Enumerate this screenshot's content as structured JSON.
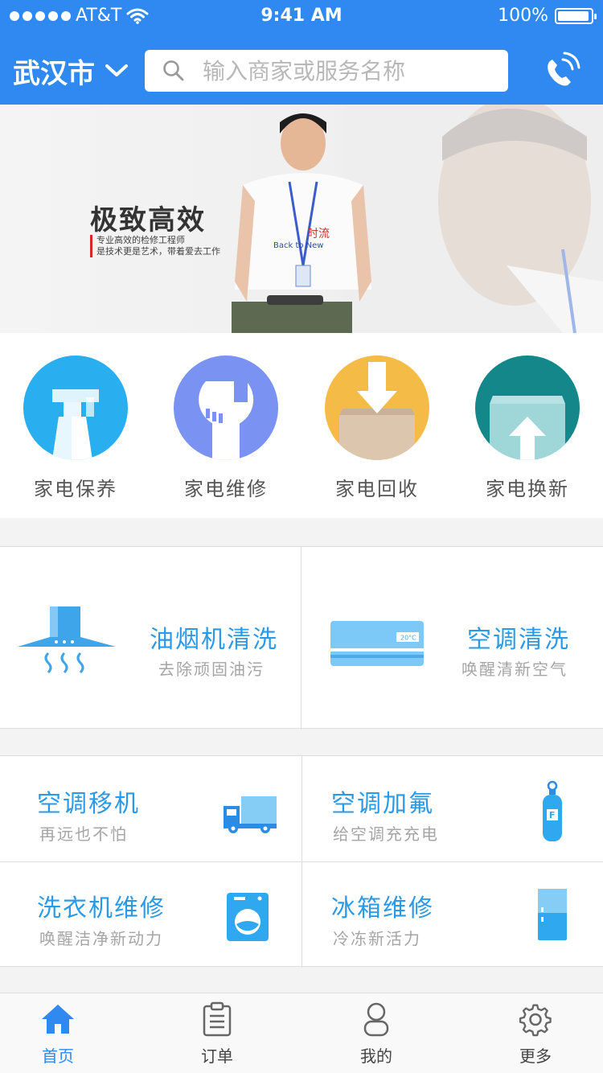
{
  "status_bar": {
    "carrier": "AT&T",
    "time": "9:41 AM",
    "battery": "100%"
  },
  "header": {
    "city": "武汉市",
    "search_placeholder": "输入商家或服务名称",
    "accent_color": "#2f89f0"
  },
  "banner": {
    "title": "极致高效",
    "subtitle_line1": "专业高效的检修工程师",
    "subtitle_line2": "是技术更是艺术，带着爱去工作",
    "shirt_text": "Back to New",
    "shirt_text2": "时流"
  },
  "categories": [
    {
      "label": "家电保养",
      "icon": "spray-bottle-icon",
      "color": "#29aef0"
    },
    {
      "label": "家电维修",
      "icon": "wrench-icon",
      "color": "#7a93f2"
    },
    {
      "label": "家电回收",
      "icon": "box-down-icon",
      "color": "#f5bb47"
    },
    {
      "label": "家电换新",
      "icon": "box-up-icon",
      "color": "#13878a"
    }
  ],
  "featured_services": [
    {
      "title": "油烟机清洗",
      "subtitle": "去除顽固油污",
      "icon": "range-hood-icon"
    },
    {
      "title": "空调清洗",
      "subtitle": "唤醒清新空气",
      "icon": "air-conditioner-icon",
      "display": "20°C"
    }
  ],
  "services": [
    {
      "title": "空调移机",
      "subtitle": "再远也不怕",
      "icon": "truck-icon"
    },
    {
      "title": "空调加氟",
      "subtitle": "给空调充充电",
      "icon": "gas-cylinder-icon",
      "badge": "F"
    },
    {
      "title": "洗衣机维修",
      "subtitle": "唤醒洁净新动力",
      "icon": "washing-machine-icon"
    },
    {
      "title": "冰箱维修",
      "subtitle": "冷冻新活力",
      "icon": "fridge-icon"
    }
  ],
  "tabbar": [
    {
      "label": "首页",
      "icon": "home-icon",
      "active": true
    },
    {
      "label": "订单",
      "icon": "clipboard-icon",
      "active": false
    },
    {
      "label": "我的",
      "icon": "user-icon",
      "active": false
    },
    {
      "label": "更多",
      "icon": "gear-icon",
      "active": false
    }
  ]
}
